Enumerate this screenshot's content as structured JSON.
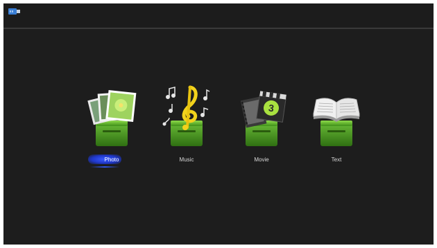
{
  "topbar": {
    "status_icon": "usb-drive-icon"
  },
  "menu": {
    "selected_index": 0,
    "items": [
      {
        "label": "Photo",
        "icon": "photo-icon"
      },
      {
        "label": "Music",
        "icon": "music-icon"
      },
      {
        "label": "Movie",
        "icon": "movie-icon"
      },
      {
        "label": "Text",
        "icon": "text-icon"
      }
    ]
  },
  "colors": {
    "background": "#1d1d1d",
    "accent_green": "#5dbb2c",
    "highlight_blue": "#2f55e8",
    "label_text": "#d8d8d8"
  }
}
